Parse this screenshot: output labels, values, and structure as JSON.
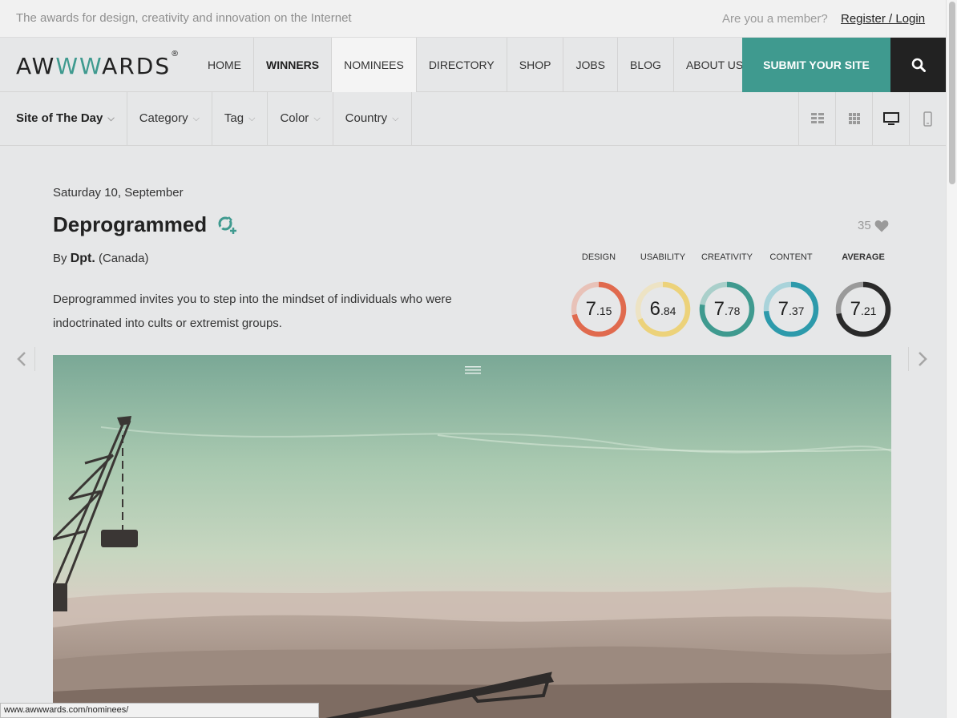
{
  "topbar": {
    "tagline": "The awards for design, creativity and innovation on the Internet",
    "member_text": "Are you a member?",
    "register_link": "Register / Login"
  },
  "nav": {
    "logo_prefix": "AW",
    "logo_ww": "WW",
    "logo_suffix": "ARDS",
    "logo_mark": "®",
    "items": [
      "HOME",
      "WINNERS",
      "NOMINEES",
      "DIRECTORY",
      "SHOP",
      "JOBS",
      "BLOG",
      "ABOUT US"
    ],
    "active": "NOMINEES",
    "submit": "SUBMIT YOUR SITE",
    "search_icon": "search-icon"
  },
  "filters": {
    "items": [
      "Site of The Day",
      "Category",
      "Tag",
      "Color",
      "Country"
    ],
    "view_icons": [
      "grid-large-icon",
      "grid-small-icon",
      "desktop-icon",
      "mobile-icon"
    ]
  },
  "site": {
    "date": "Saturday 10, September",
    "title": "Deprogrammed",
    "by_prefix": "By",
    "author": "Dpt.",
    "country": "(Canada)",
    "description": "Deprogrammed invites you to step into the mindset of individuals who were indoctrinated into cults or extremist groups.",
    "likes": "35"
  },
  "scores": [
    {
      "label": "DESIGN",
      "int": "7",
      "dec": ".15",
      "value": 7.15,
      "color": "#e06a4e",
      "track": "#e8c2b8"
    },
    {
      "label": "USABILITY",
      "int": "6",
      "dec": ".84",
      "value": 6.84,
      "color": "#ecd27a",
      "track": "#ede3c4"
    },
    {
      "label": "CREATIVITY",
      "int": "7",
      "dec": ".78",
      "value": 7.78,
      "color": "#3f9a8f",
      "track": "#a9cfca"
    },
    {
      "label": "CONTENT",
      "int": "7",
      "dec": ".37",
      "value": 7.37,
      "color": "#2d9aab",
      "track": "#a9d3da"
    },
    {
      "label": "AVERAGE",
      "int": "7",
      "dec": ".21",
      "value": 7.21,
      "color": "#2a2a2a",
      "track": "#9a9a9a"
    }
  ],
  "status_url": "www.awwwards.com/nominees/"
}
